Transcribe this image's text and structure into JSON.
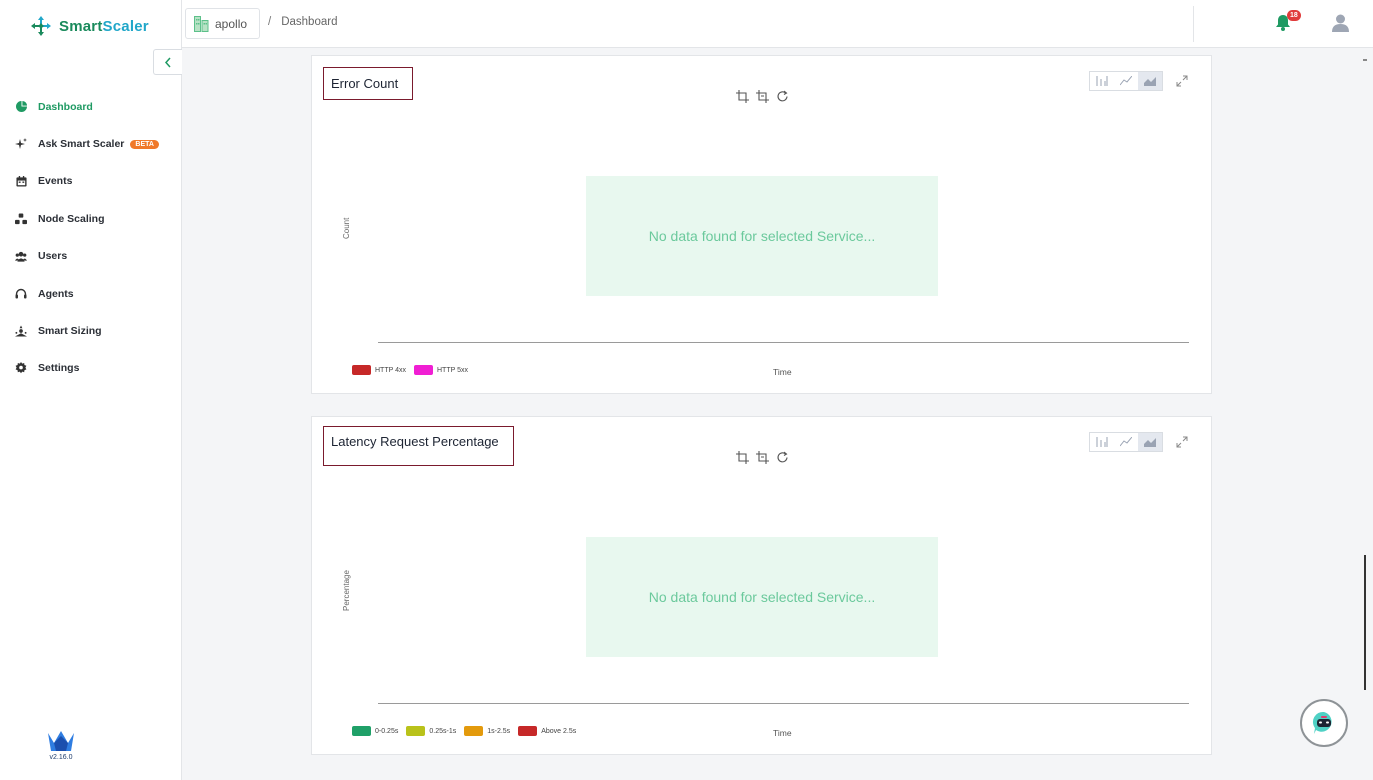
{
  "app": {
    "brand_smart": "Smart",
    "brand_scaler": "Scaler",
    "version": "v2.16.0"
  },
  "sidebar": {
    "items": [
      {
        "label": "Dashboard",
        "icon": "dashboard-pie-icon",
        "active": true
      },
      {
        "label": "Ask Smart Scaler",
        "icon": "sparkle-icon",
        "badge": "BETA"
      },
      {
        "label": "Events",
        "icon": "calendar-icon"
      },
      {
        "label": "Node Scaling",
        "icon": "nodes-icon"
      },
      {
        "label": "Users",
        "icon": "users-icon"
      },
      {
        "label": "Agents",
        "icon": "headset-icon"
      },
      {
        "label": "Smart Sizing",
        "icon": "sizing-icon"
      },
      {
        "label": "Settings",
        "icon": "gear-icon"
      }
    ]
  },
  "topbar": {
    "cluster": "apollo",
    "separator": "/",
    "breadcrumb": "Dashboard",
    "notification_count": "18"
  },
  "colors": {
    "accent": "#1f9a63",
    "no_data_bg": "#e8f8ef",
    "no_data_text": "#6bc99c"
  },
  "cards": [
    {
      "title": "Error Count",
      "ylabel": "Count",
      "xlabel": "Time",
      "no_data": "No data found for selected Service...",
      "legend": [
        {
          "label": "HTTP 4xx",
          "color": "#c62828"
        },
        {
          "label": "HTTP 5xx",
          "color": "#f01fd3"
        }
      ]
    },
    {
      "title": "Latency Request Percentage",
      "ylabel": "Percentage",
      "xlabel": "Time",
      "no_data": "No data found for selected Service...",
      "legend": [
        {
          "label": "0-0.25s",
          "color": "#1fa068"
        },
        {
          "label": "0.25s-1s",
          "color": "#b9c21a"
        },
        {
          "label": "1s-2.5s",
          "color": "#e39a0c"
        },
        {
          "label": "Above 2.5s",
          "color": "#c62828"
        }
      ]
    }
  ]
}
